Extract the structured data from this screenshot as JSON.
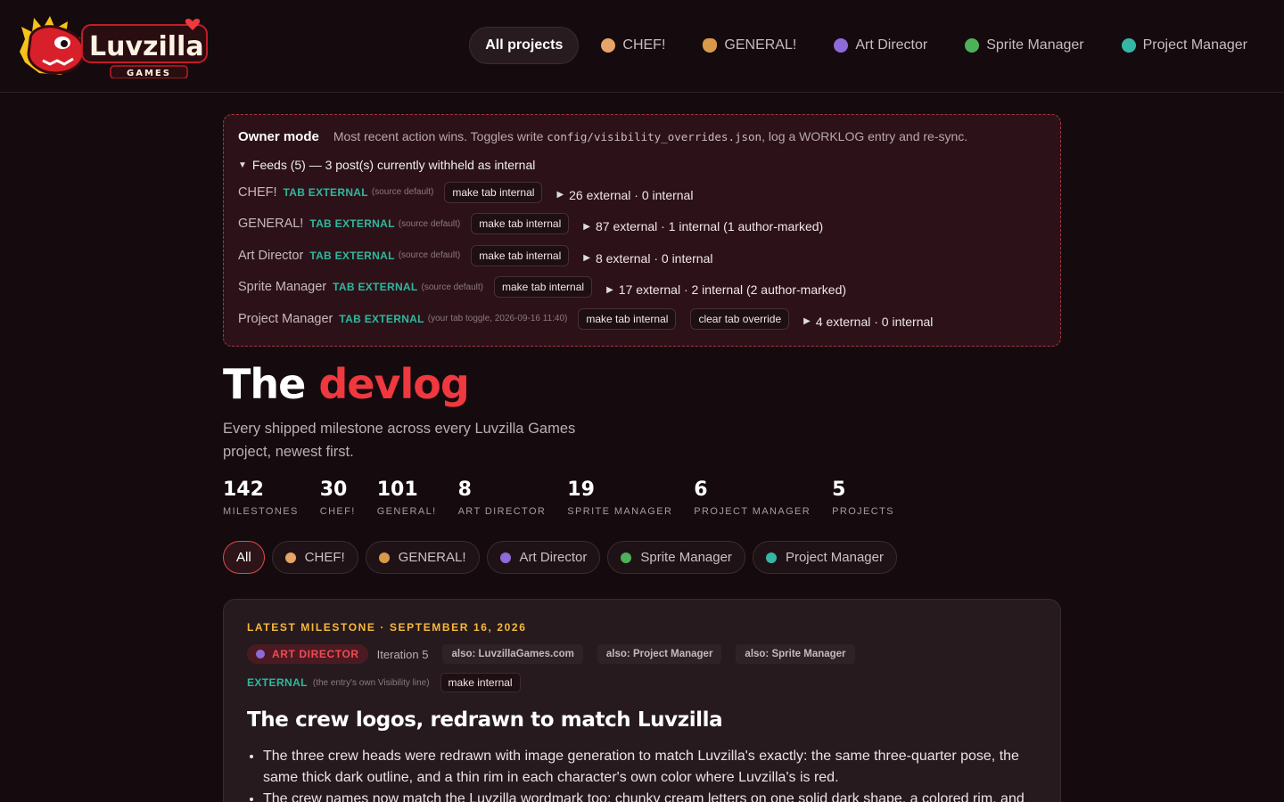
{
  "brand": {
    "logo_word": "Luvzilla",
    "logo_sub": "GAMES",
    "red": "#f0383f",
    "teal": "#2fb89e",
    "gold": "#f6b93b"
  },
  "nav": [
    {
      "label": "All projects",
      "icon": "none",
      "active": true
    },
    {
      "label": "CHEF!",
      "icon": "chef-icon",
      "color": "#e8a36a"
    },
    {
      "label": "GENERAL!",
      "icon": "general-icon",
      "color": "#d89a4a"
    },
    {
      "label": "Art Director",
      "icon": "art-director-icon",
      "color": "#8f6ad9"
    },
    {
      "label": "Sprite Manager",
      "icon": "sprite-manager-icon",
      "color": "#4fb05a"
    },
    {
      "label": "Project Manager",
      "icon": "project-manager-icon",
      "color": "#35b7a6"
    }
  ],
  "owner": {
    "title": "Owner mode",
    "note_pre": "Most recent action wins. Toggles write ",
    "note_code": "config/visibility_overrides.json",
    "note_post": ", log a WORKLOG entry and re-sync.",
    "feeds_summary": "Feeds (5) — 3 post(s) currently withheld as internal",
    "feeds": [
      {
        "name": "CHEF!",
        "tab": "TAB EXTERNAL",
        "source": "(source default)",
        "buttons": [
          "make tab internal"
        ],
        "counts": "26 external · 0 internal"
      },
      {
        "name": "GENERAL!",
        "tab": "TAB EXTERNAL",
        "source": "(source default)",
        "buttons": [
          "make tab internal"
        ],
        "counts": "87 external · 1 internal (1 author-marked)"
      },
      {
        "name": "Art Director",
        "tab": "TAB EXTERNAL",
        "source": "(source default)",
        "buttons": [
          "make tab internal"
        ],
        "counts": "8 external · 0 internal"
      },
      {
        "name": "Sprite Manager",
        "tab": "TAB EXTERNAL",
        "source": "(source default)",
        "buttons": [
          "make tab internal"
        ],
        "counts": "17 external · 2 internal (2 author-marked)"
      },
      {
        "name": "Project Manager",
        "tab": "TAB EXTERNAL",
        "source": "(your tab toggle, 2026-09-16 11:40)",
        "buttons": [
          "make tab internal",
          "clear tab override"
        ],
        "counts": "4 external · 0 internal"
      }
    ]
  },
  "hero": {
    "title_a": "The ",
    "title_b": "devlog",
    "subtitle": "Every shipped milestone across every Luvzilla Games project, newest first."
  },
  "stats": [
    {
      "value": "142",
      "label": "MILESTONES"
    },
    {
      "value": "30",
      "label": "CHEF!"
    },
    {
      "value": "101",
      "label": "GENERAL!"
    },
    {
      "value": "8",
      "label": "ART DIRECTOR"
    },
    {
      "value": "19",
      "label": "SPRITE MANAGER"
    },
    {
      "value": "6",
      "label": "PROJECT MANAGER"
    },
    {
      "value": "5",
      "label": "PROJECTS"
    }
  ],
  "filters": [
    {
      "label": "All",
      "icon": "none",
      "active": true
    },
    {
      "label": "CHEF!",
      "icon": "chef-icon",
      "color": "#e8a36a"
    },
    {
      "label": "GENERAL!",
      "icon": "general-icon",
      "color": "#d89a4a"
    },
    {
      "label": "Art Director",
      "icon": "art-director-icon",
      "color": "#8f6ad9"
    },
    {
      "label": "Sprite Manager",
      "icon": "sprite-manager-icon",
      "color": "#4fb05a"
    },
    {
      "label": "Project Manager",
      "icon": "project-manager-icon",
      "color": "#35b7a6"
    }
  ],
  "card": {
    "kicker": "LATEST MILESTONE · SEPTEMBER 16, 2026",
    "tag": "ART DIRECTOR",
    "iteration": "Iteration 5",
    "also": [
      "also: LuvzillaGames.com",
      "also: Project Manager",
      "also: Sprite Manager"
    ],
    "visibility": "EXTERNAL",
    "visibility_source": "(the entry's own Visibility line)",
    "make_internal": "make internal",
    "title": "The crew logos, redrawn to match Luvzilla",
    "bullets": [
      "The three crew heads were redrawn with image generation to match Luvzilla's exactly: the same three-quarter pose, the same thick dark outline, and a thin rim in each character's own color where Luvzilla's is red.",
      "The crew names now match the Luvzilla wordmark too: chunky cream letters on one solid dark shape, a colored rim, and"
    ]
  }
}
